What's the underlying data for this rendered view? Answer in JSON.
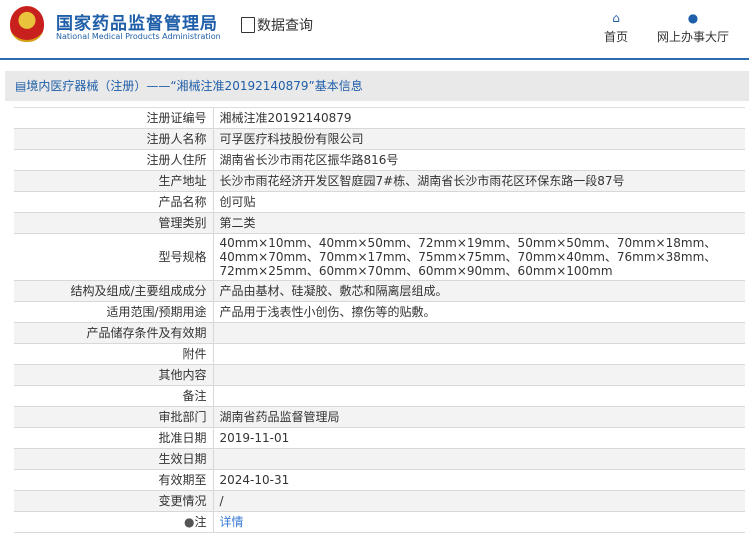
{
  "header": {
    "logo_cn": "国家药品监督管理局",
    "logo_en": "National Medical Products Administration",
    "data_query": "数据查询",
    "nav": [
      {
        "label": "首页",
        "icon": "home-icon"
      },
      {
        "label": "网上办事大厅",
        "icon": "user-icon"
      }
    ]
  },
  "title": "境内医疗器械（注册）——“湘械注准20192140879”基本信息",
  "rows": [
    {
      "label": "注册证编号",
      "value": "湘械注准20192140879"
    },
    {
      "label": "注册人名称",
      "value": "可孚医疗科技股份有限公司"
    },
    {
      "label": "注册人住所",
      "value": "湖南省长沙市雨花区振华路816号"
    },
    {
      "label": "生产地址",
      "value": "长沙市雨花经济开发区智庭园7#栋、湖南省长沙市雨花区环保东路一段87号"
    },
    {
      "label": "产品名称",
      "value": "创可贴"
    },
    {
      "label": "管理类别",
      "value": "第二类"
    },
    {
      "label": "型号规格",
      "value": "40mm×10mm、40mm×50mm、72mm×19mm、50mm×50mm、70mm×18mm、40mm×70mm、70mm×17mm、75mm×75mm、70mm×40mm、76mm×38mm、72mm×25mm、60mm×70mm、60mm×90mm、60mm×100mm"
    },
    {
      "label": "结构及组成/主要组成成分",
      "value": "产品由基材、硅凝胶、敷芯和隔离层组成。"
    },
    {
      "label": "适用范围/预期用途",
      "value": "产品用于浅表性小创伤、擦伤等的贴敷。"
    },
    {
      "label": "产品储存条件及有效期",
      "value": ""
    },
    {
      "label": "附件",
      "value": ""
    },
    {
      "label": "其他内容",
      "value": ""
    },
    {
      "label": "备注",
      "value": ""
    },
    {
      "label": "审批部门",
      "value": "湖南省药品监督管理局"
    },
    {
      "label": "批准日期",
      "value": "2019-11-01"
    },
    {
      "label": "生效日期",
      "value": ""
    },
    {
      "label": "有效期至",
      "value": "2024-10-31"
    },
    {
      "label": "变更情况",
      "value": "/"
    }
  ],
  "note": {
    "label": "注",
    "link": "详情"
  }
}
